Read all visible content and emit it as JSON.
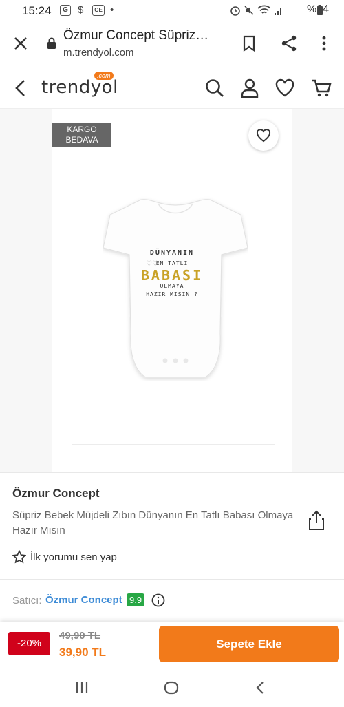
{
  "status_bar": {
    "time": "15:24",
    "battery": "%94"
  },
  "browser": {
    "title": "Özmur Concept Süpriz…",
    "url": "m.trendyol.com"
  },
  "site": {
    "logo": "trendyol",
    "logo_suffix": ".com"
  },
  "product": {
    "badge_line1": "KARGO",
    "badge_line2": "BEDAVA",
    "print_line1": "DÜNYANIN",
    "print_line2": "EN TATLI",
    "print_line3": "BABASI",
    "print_line4": "OLMAYA",
    "print_line5": "HAZIR MISIN ?",
    "brand": "Özmur Concept",
    "name": "Süpriz Bebek Müjdeli Zıbın Dünyanın En Tatlı Babası Olmaya Hazır Mısın",
    "review_cta": "İlk yorumu sen yap"
  },
  "seller": {
    "label": "Satıcı:",
    "name": "Özmur Concept",
    "score": "9.9"
  },
  "purchase": {
    "discount": "-20%",
    "old_price": "49,90 TL",
    "new_price": "39,90 TL",
    "add_to_cart": "Sepete Ekle"
  },
  "colors": {
    "accent": "#f27a1a",
    "discount": "#d0021b",
    "seller_link": "#3d8bd6",
    "score": "#28a745"
  },
  "icons": [
    "close-icon",
    "lock-icon",
    "bookmark-icon",
    "share-icon",
    "more-vert-icon",
    "back-arrow-icon",
    "search-icon",
    "user-icon",
    "heart-icon",
    "cart-icon",
    "star-icon",
    "info-icon"
  ]
}
